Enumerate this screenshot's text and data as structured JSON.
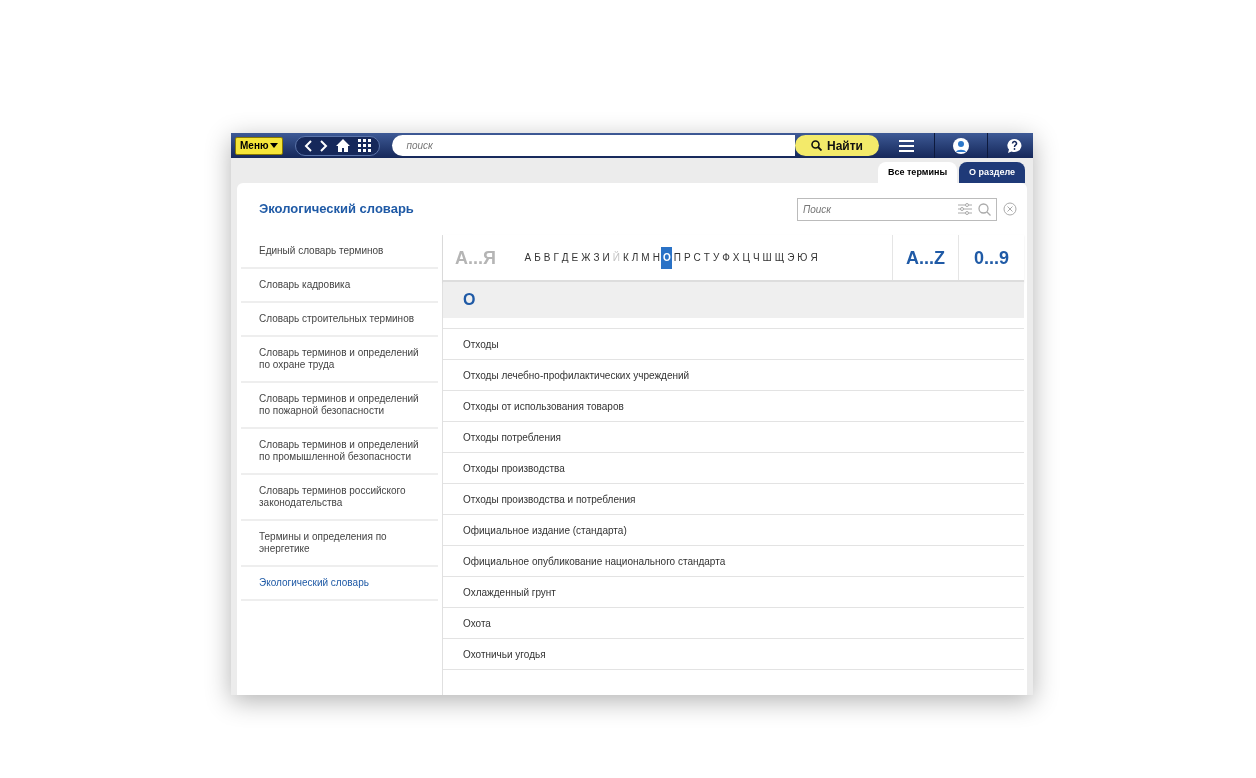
{
  "toolbar": {
    "menu_label": "Меню",
    "search_placeholder": "поиск",
    "find_label": "Найти"
  },
  "tabs": [
    {
      "label": "Все термины",
      "selected": true
    },
    {
      "label": "О разделе",
      "selected": false
    }
  ],
  "title": "Экологический словарь",
  "search": {
    "placeholder": "Поиск"
  },
  "sidebar": {
    "items": [
      {
        "label": "Единый словарь терминов",
        "selected": false
      },
      {
        "label": "Словарь кадровика",
        "selected": false
      },
      {
        "label": "Словарь строительных терминов",
        "selected": false
      },
      {
        "label": "Словарь терминов и определений по охране труда",
        "selected": false
      },
      {
        "label": "Словарь терминов и определений по пожарной безопасности",
        "selected": false
      },
      {
        "label": "Словарь терминов и определений по промышленной безопасности",
        "selected": false
      },
      {
        "label": "Словарь терминов российского законодательства",
        "selected": false
      },
      {
        "label": "Термины и определения по энергетике",
        "selected": false
      },
      {
        "label": "Экологический словарь",
        "selected": true
      }
    ]
  },
  "alphabet": {
    "range_cyrillic": {
      "label": "А...Я",
      "disabled": true
    },
    "letters": [
      {
        "label": "А",
        "selected": false,
        "disabled": false
      },
      {
        "label": "Б",
        "selected": false,
        "disabled": false
      },
      {
        "label": "В",
        "selected": false,
        "disabled": false
      },
      {
        "label": "Г",
        "selected": false,
        "disabled": false
      },
      {
        "label": "Д",
        "selected": false,
        "disabled": false
      },
      {
        "label": "Е",
        "selected": false,
        "disabled": false
      },
      {
        "label": "Ж",
        "selected": false,
        "disabled": false
      },
      {
        "label": "З",
        "selected": false,
        "disabled": false
      },
      {
        "label": "И",
        "selected": false,
        "disabled": false
      },
      {
        "label": "Й",
        "selected": false,
        "disabled": true
      },
      {
        "label": "К",
        "selected": false,
        "disabled": false
      },
      {
        "label": "Л",
        "selected": false,
        "disabled": false
      },
      {
        "label": "М",
        "selected": false,
        "disabled": false
      },
      {
        "label": "Н",
        "selected": false,
        "disabled": false
      },
      {
        "label": "О",
        "selected": true,
        "disabled": false
      },
      {
        "label": "П",
        "selected": false,
        "disabled": false
      },
      {
        "label": "Р",
        "selected": false,
        "disabled": false
      },
      {
        "label": "С",
        "selected": false,
        "disabled": false
      },
      {
        "label": "Т",
        "selected": false,
        "disabled": false
      },
      {
        "label": "У",
        "selected": false,
        "disabled": false
      },
      {
        "label": "Ф",
        "selected": false,
        "disabled": false
      },
      {
        "label": "Х",
        "selected": false,
        "disabled": false
      },
      {
        "label": "Ц",
        "selected": false,
        "disabled": false
      },
      {
        "label": "Ч",
        "selected": false,
        "disabled": false
      },
      {
        "label": "Ш",
        "selected": false,
        "disabled": false
      },
      {
        "label": "Щ",
        "selected": false,
        "disabled": false
      },
      {
        "label": "Э",
        "selected": false,
        "disabled": false
      },
      {
        "label": "Ю",
        "selected": false,
        "disabled": false
      },
      {
        "label": "Я",
        "selected": false,
        "disabled": false
      }
    ],
    "range_latin": {
      "label": "A...Z",
      "disabled": false
    },
    "range_digits": {
      "label": "0...9",
      "disabled": false
    }
  },
  "section_letter": "О",
  "terms": [
    "Отходы",
    "Отходы лечебно-профилактических учреждений",
    "Отходы от использования товаров",
    "Отходы потребления",
    "Отходы производства",
    "Отходы производства и потребления",
    "Официальное издание (стандарта)",
    "Официальное опубликование национального стандарта",
    "Охлажденный грунт",
    "Охота",
    "Охотничьи угодья"
  ]
}
